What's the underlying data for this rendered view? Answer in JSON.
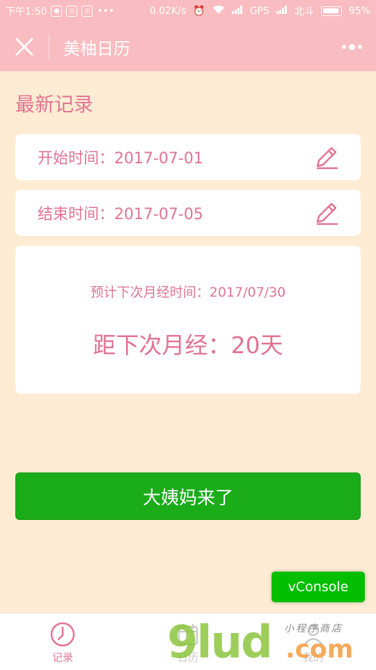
{
  "status_bar": {
    "time": "下午1:50",
    "dots": "•••",
    "speed": "0.02K/s",
    "gps": "GPS",
    "carrier": "北斗",
    "battery": "95%"
  },
  "nav": {
    "title": "美柚日历"
  },
  "section_title": "最新记录",
  "start_row": {
    "text": "开始时间：2017-07-01"
  },
  "end_row": {
    "text": "结束时间：2017-07-05"
  },
  "summary": {
    "predict": "预计下次月经时间：2017/07/30",
    "countdown": "距下次月经：20天"
  },
  "main_button": "大姨妈来了",
  "vconsole": "vConsole",
  "tabs": [
    {
      "label": "记录",
      "icon": "clock-icon"
    },
    {
      "label": "日历",
      "icon": "calendar-icon"
    },
    {
      "label": "我的",
      "icon": "user-icon"
    }
  ],
  "watermark": {
    "logo": "9lud",
    "com": ".com",
    "small": "小程序商店"
  },
  "colors": {
    "pink_header": "#f9bcc0",
    "accent": "#e27393",
    "bg": "#fdecd3",
    "green": "#1aad19"
  }
}
